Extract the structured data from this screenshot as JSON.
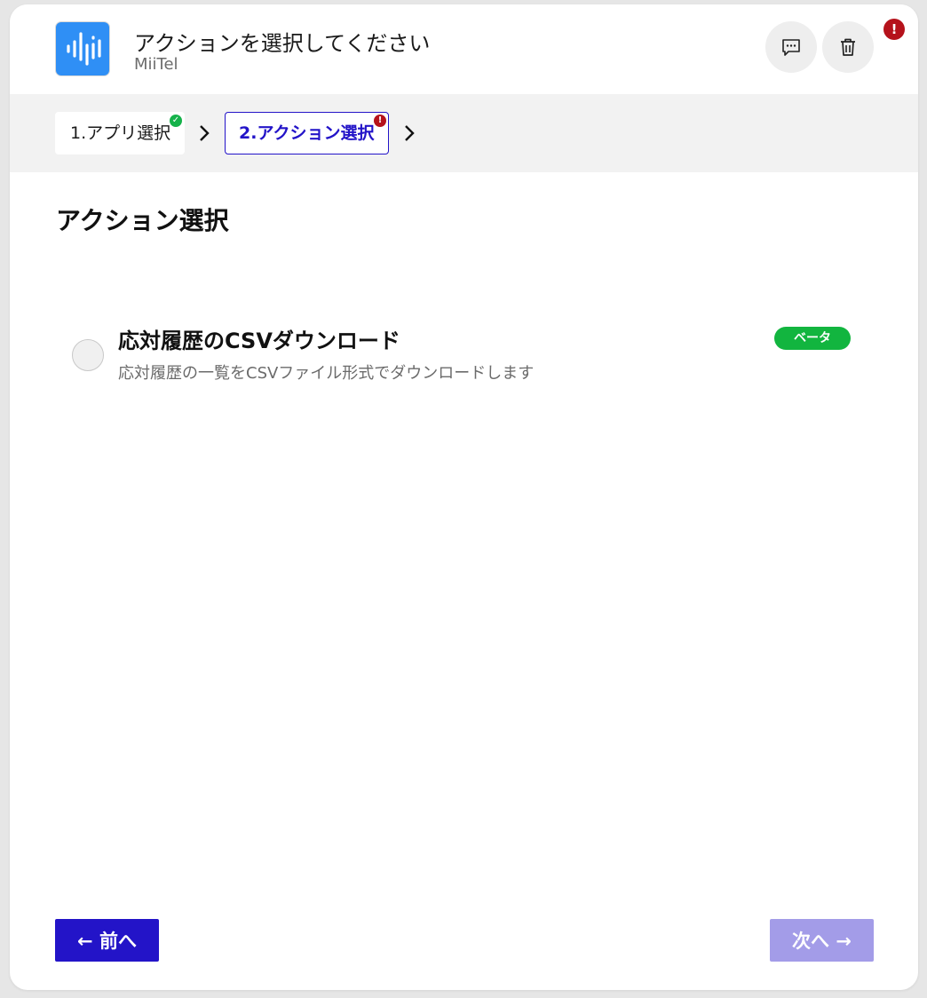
{
  "header": {
    "title": "アクションを選択してください",
    "subtitle": "MiiTel",
    "logo_icon": "waveform-icon",
    "comment_icon": "comment-icon",
    "delete_icon": "trash-icon",
    "alert_mark": "!"
  },
  "steps": [
    {
      "label": "1.アプリ選択",
      "status": "complete",
      "status_icon": "check-icon"
    },
    {
      "label": "2.アクション選択",
      "status": "error",
      "status_icon": "exclamation-icon",
      "error_mark": "!"
    }
  ],
  "main": {
    "section_title": "アクション選択",
    "options": [
      {
        "title": "応対履歴のCSVダウンロード",
        "description": "応対履歴の一覧をCSVファイル形式でダウンロードします",
        "badge": "ベータ",
        "selected": false
      }
    ]
  },
  "footer": {
    "prev_label": "← 前へ",
    "next_label": "次へ →"
  },
  "colors": {
    "accent": "#2314c8",
    "accent_disabled": "#a39ce8",
    "success": "#15b24a",
    "error": "#b5121b",
    "beta": "#12b53f",
    "logo": "#2f8ff5"
  }
}
